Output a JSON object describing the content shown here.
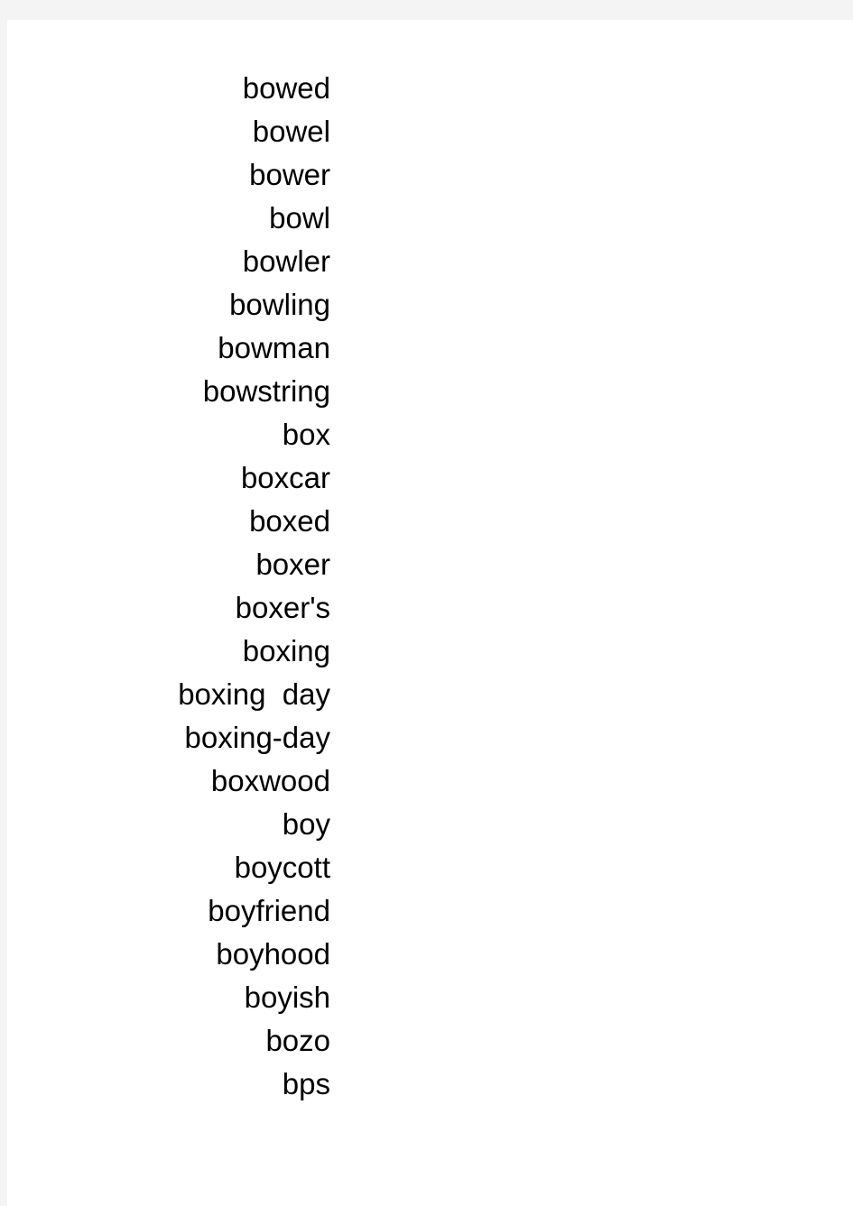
{
  "page": {
    "background_color": "#f4f4f4",
    "sheet_color": "#ffffff",
    "text_color": "#000000",
    "alignment": "right"
  },
  "word_list": {
    "items": [
      {
        "word": "bowed"
      },
      {
        "word": "bowel"
      },
      {
        "word": "bower"
      },
      {
        "word": "bowl"
      },
      {
        "word": "bowler"
      },
      {
        "word": "bowling"
      },
      {
        "word": "bowman"
      },
      {
        "word": "bowstring"
      },
      {
        "word": "box"
      },
      {
        "word": "boxcar"
      },
      {
        "word": "boxed"
      },
      {
        "word": "boxer"
      },
      {
        "word": "boxer's"
      },
      {
        "word": "boxing"
      },
      {
        "word": "boxing  day"
      },
      {
        "word": "boxing-day"
      },
      {
        "word": "boxwood"
      },
      {
        "word": "boy"
      },
      {
        "word": "boycott"
      },
      {
        "word": "boyfriend"
      },
      {
        "word": "boyhood"
      },
      {
        "word": "boyish"
      },
      {
        "word": "bozo"
      },
      {
        "word": "bps"
      }
    ]
  }
}
